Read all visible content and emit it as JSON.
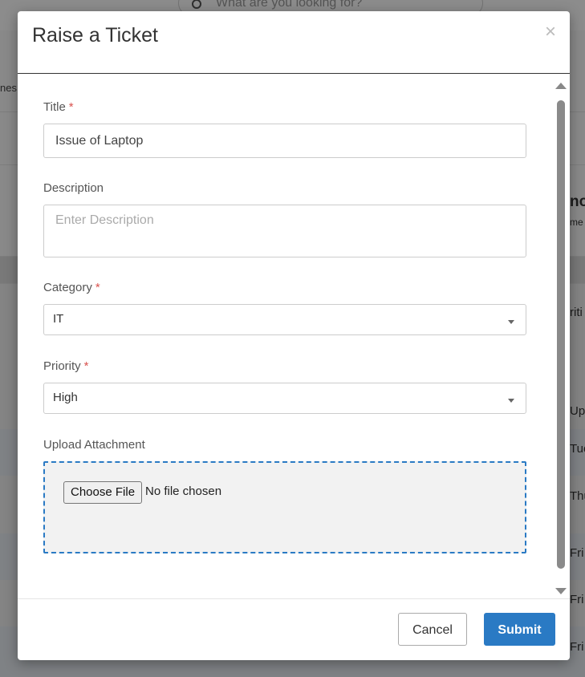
{
  "background": {
    "search_placeholder": "What are you looking for?",
    "side_text": "nes.",
    "right_texts": [
      "no",
      "me",
      "riti",
      "Up",
      "Tue",
      "Thu",
      "Fri",
      "Fri",
      "Fri"
    ]
  },
  "modal": {
    "title": "Raise a Ticket",
    "close_glyph": "×",
    "fields": {
      "title": {
        "label": "Title",
        "required_mark": "*",
        "value": "Issue of Laptop"
      },
      "description": {
        "label": "Description",
        "placeholder": "Enter Description"
      },
      "category": {
        "label": "Category",
        "required_mark": "*",
        "selected": "IT"
      },
      "priority": {
        "label": "Priority",
        "required_mark": "*",
        "selected": "High"
      },
      "attachment": {
        "label": "Upload Attachment",
        "button_label": "Choose File",
        "status": "No file chosen"
      }
    },
    "footer": {
      "cancel_label": "Cancel",
      "submit_label": "Submit"
    }
  },
  "colors": {
    "primary": "#2a7ac4",
    "required": "#d9534f",
    "dropzone_bg": "#f2f2f2"
  },
  "icons": {
    "search": "search-icon",
    "close": "close-icon",
    "caret": "chevron-down-icon"
  }
}
